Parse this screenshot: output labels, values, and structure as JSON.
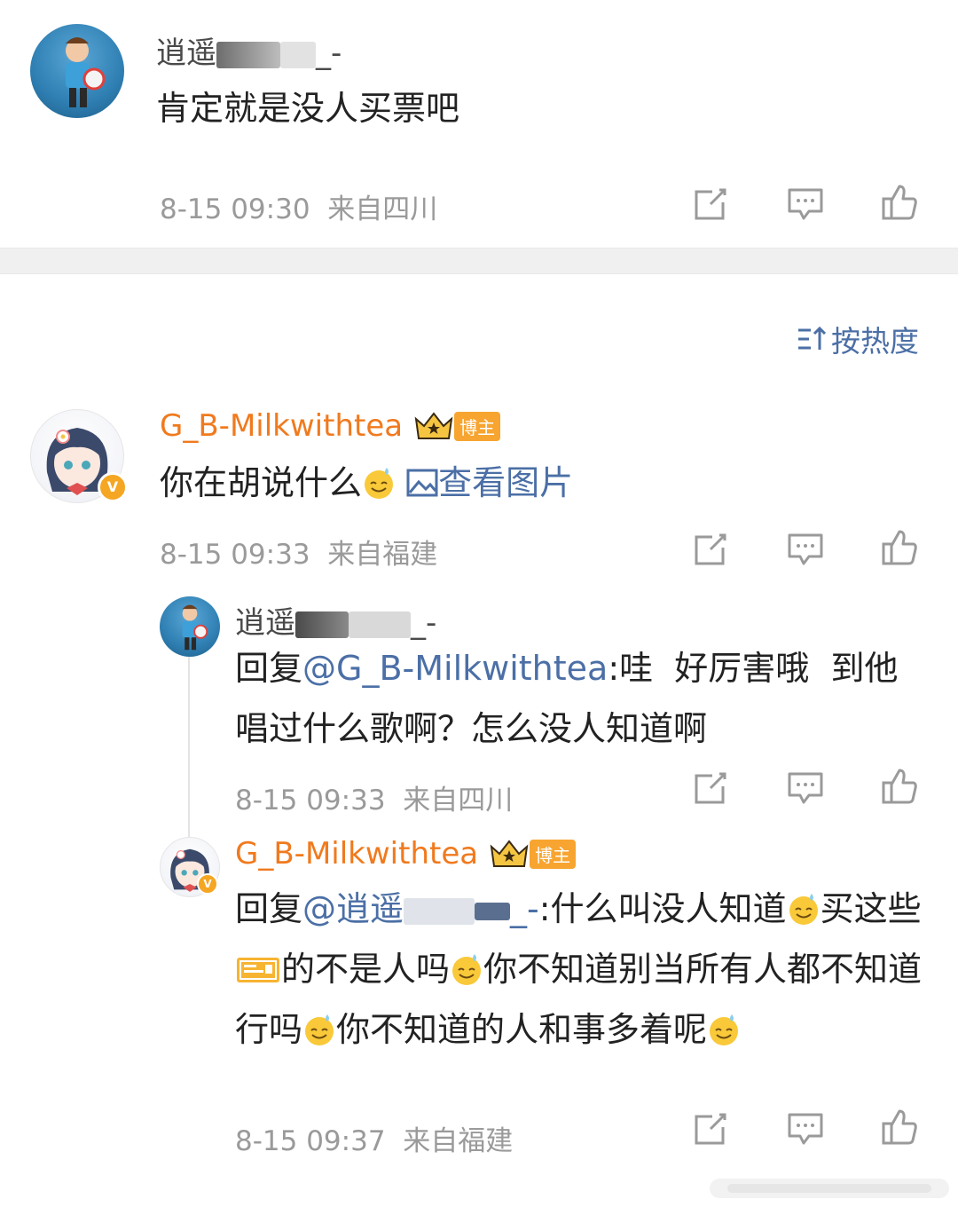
{
  "comments": [
    {
      "user": "逍遥",
      "user_tail": "_-",
      "text": "肯定就是没人买票吧",
      "time": "8-15 09:30",
      "location": "来自四川"
    }
  ],
  "sort": {
    "icon": "sort-icon",
    "label": "按热度"
  },
  "thread": {
    "main": {
      "user": "G_B-Milkwithtea",
      "badge_label": "博主",
      "text": "你在胡说什么",
      "view_image_label": "查看图片",
      "time": "8-15 09:33",
      "location": "来自福建"
    },
    "replies": [
      {
        "user": "逍遥",
        "user_tail": "_-",
        "reply_prefix": "回复",
        "mention": "@G_B-Milkwithtea",
        "text": ":哇  好厉害哦  到他唱过什么歌啊？怎么没人知道啊",
        "time": "8-15 09:33",
        "location": "来自四川"
      },
      {
        "user": "G_B-Milkwithtea",
        "badge_label": "博主",
        "reply_prefix": "回复",
        "mention": "@逍遥",
        "mention_tail": "_-",
        "text_1": ":什么叫没人知道",
        "text_2": "买这些",
        "text_3": "的不是人吗",
        "text_4": "你不知道别当所有人都不知道行吗",
        "text_5": "你不知道的人和事多着呢",
        "time": "8-15 09:37",
        "location": "来自福建"
      }
    ]
  },
  "icons": {
    "share": "share-icon",
    "comment": "comment-icon",
    "like": "like-icon",
    "crown": "crown-icon",
    "v_badge": "verified-badge-icon",
    "emoji": "sweat-smile-emoji-icon",
    "ticket": "ticket-icon",
    "image": "image-icon"
  },
  "colors": {
    "name_orange": "#f07a1e",
    "link_blue": "#4b6fa6",
    "meta_gray": "#9a9a9a"
  }
}
